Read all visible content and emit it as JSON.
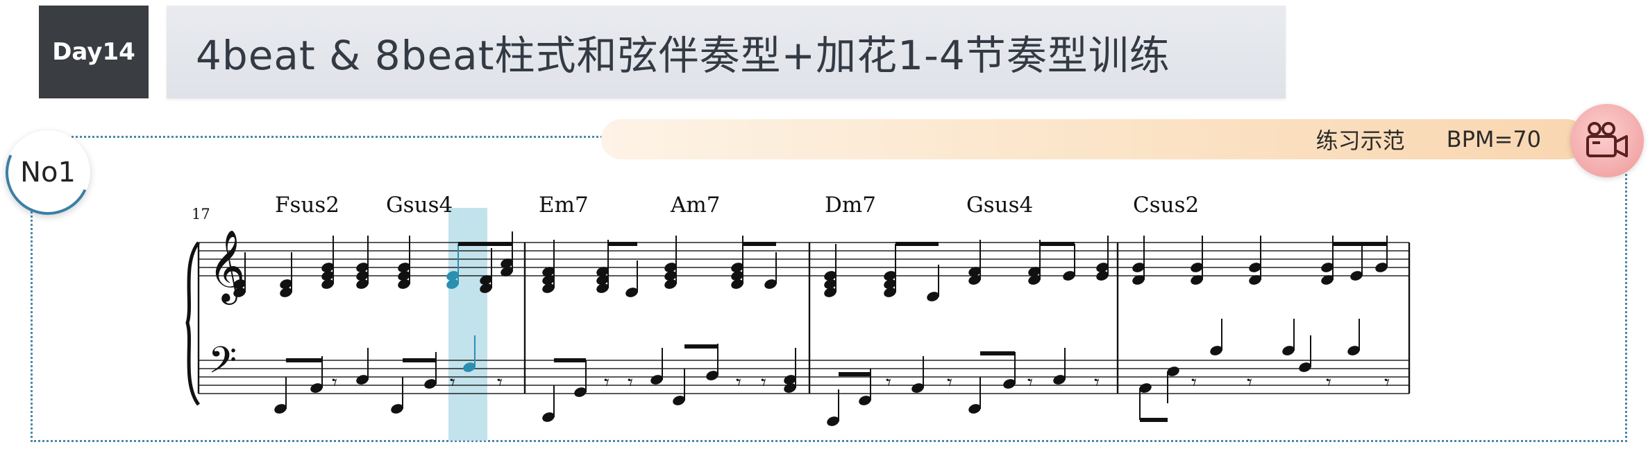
{
  "header": {
    "day_label": "Day14",
    "title": "4beat & 8beat柱式和弦伴奏型+加花1-4节奏型训练"
  },
  "exercise": {
    "number_label": "No1",
    "demo_label": "练习示范",
    "bpm_label": "BPM=70",
    "video_icon": "video-camera-icon",
    "bar_start_number": "17",
    "chords": [
      "Fsus2",
      "Gsus4",
      "Em7",
      "Am7",
      "Dm7",
      "Gsus4",
      "Csus2"
    ],
    "highlight_color": "#add8e6",
    "highlight_note_color": "#2a8fb0"
  }
}
